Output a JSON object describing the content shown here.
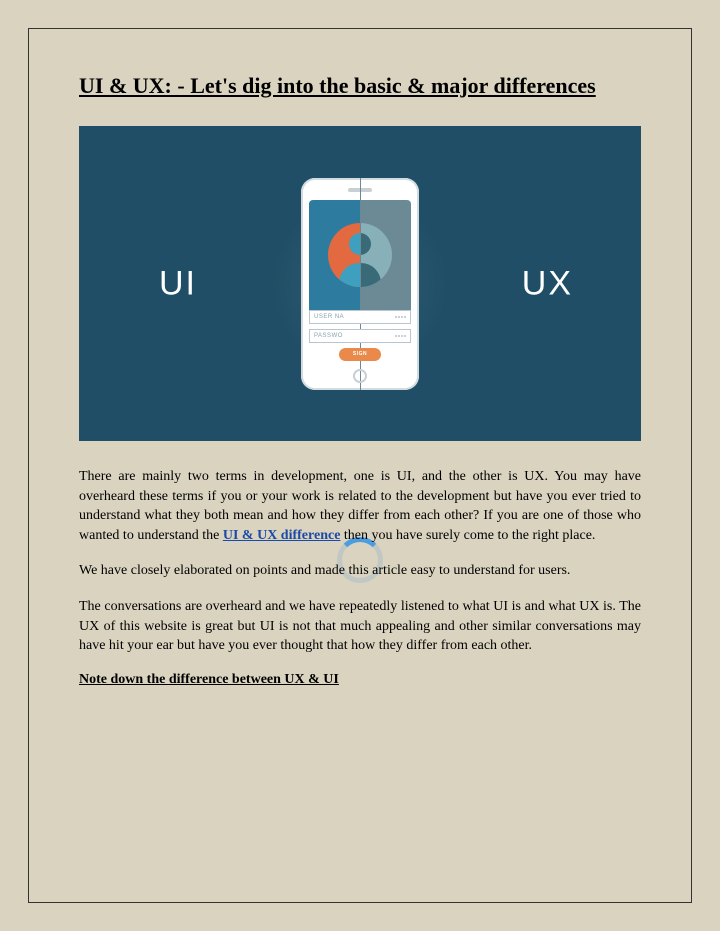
{
  "title": "UI & UX: - Let's dig into the basic & major differences",
  "hero": {
    "leftLabel": "UI",
    "rightLabel": "UX",
    "form": {
      "field1": "USER NA",
      "field2": "PASSWO",
      "button": "SIGN"
    }
  },
  "body": {
    "p1a": "There are mainly two terms in development, one is UI, and the other is UX. You may have overheard these terms if you or your work is related to the development but have you ever tried to understand what they both mean and how they differ from each other? If you are one of those who wanted to understand the ",
    "p1link": "UI & UX difference",
    "p1b": " then you have surely come to the right place.",
    "p2": "We have closely elaborated on points and made this article easy to understand for users.",
    "p3": "The conversations are overheard and we have repeatedly listened to what UI is and what UX is. The UX of this website is great but UI is not that much appealing and other similar conversations may have hit your ear but have you ever thought that how they differ from each other.",
    "subheading": "Note down the difference between UX & UI"
  }
}
